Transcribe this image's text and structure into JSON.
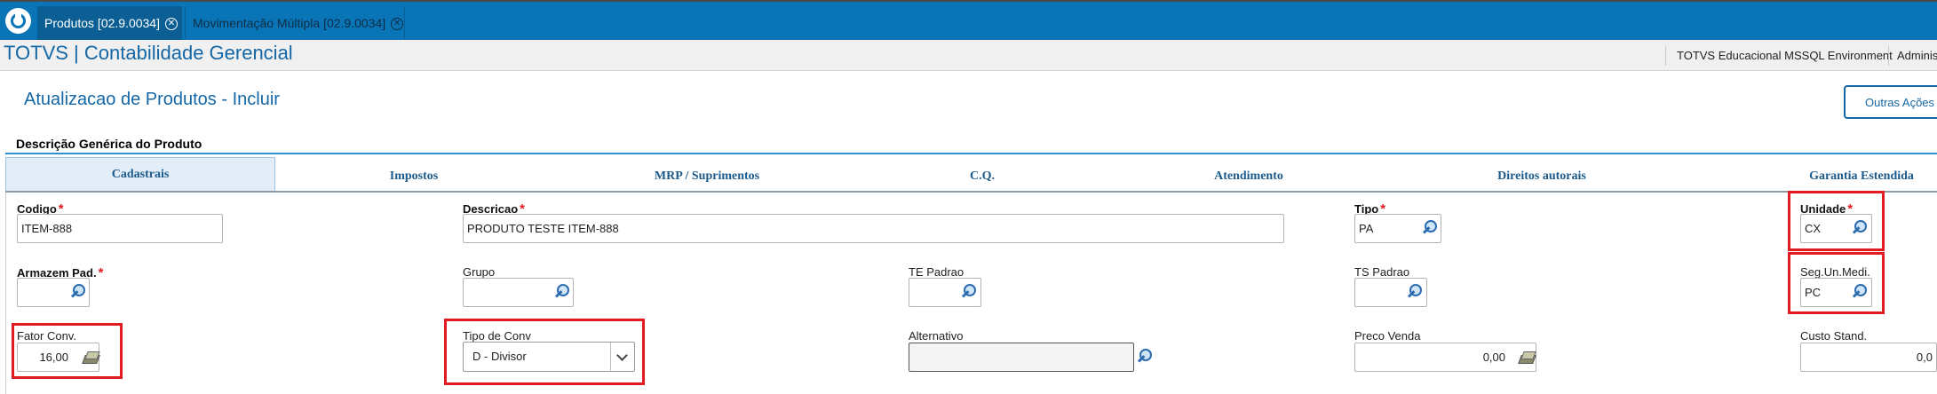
{
  "tabs": [
    {
      "label": "Produtos [02.9.0034]",
      "active": true
    },
    {
      "label": "Movimentação Múltipla [02.9.0034]",
      "active": false
    }
  ],
  "header": {
    "app_title": "TOTVS | Contabilidade Gerencial",
    "environment": "TOTVS Educacional MSSQL Environment",
    "user": "Administ"
  },
  "page": {
    "title": "Atualizacao de Produtos - Incluir",
    "outras_acoes": "Outras Ações",
    "section": "Descrição Genérica do Produto"
  },
  "folders": [
    "Cadastrais",
    "Impostos",
    "MRP / Suprimentos",
    "C.Q.",
    "Atendimento",
    "Direitos autorais",
    "Garantia Estendida"
  ],
  "form": {
    "codigo": {
      "label": "Codigo",
      "value": "ITEM-888"
    },
    "descricao": {
      "label": "Descricao",
      "value": "PRODUTO TESTE ITEM-888"
    },
    "tipo": {
      "label": "Tipo",
      "value": "PA"
    },
    "unidade": {
      "label": "Unidade",
      "value": "CX"
    },
    "armazem": {
      "label": "Armazem Pad.",
      "value": ""
    },
    "grupo": {
      "label": "Grupo",
      "value": ""
    },
    "te_padrao": {
      "label": "TE Padrao",
      "value": ""
    },
    "ts_padrao": {
      "label": "TS Padrao",
      "value": ""
    },
    "seg_un": {
      "label": "Seg.Un.Medi.",
      "value": "PC"
    },
    "fator_conv": {
      "label": "Fator Conv.",
      "value": "16,00"
    },
    "tipo_conv": {
      "label": "Tipo de Conv",
      "value": "D - Divisor"
    },
    "alternativo": {
      "label": "Alternativo",
      "value": ""
    },
    "preco_venda": {
      "label": "Preco Venda",
      "value": "0,00"
    },
    "custo_stand": {
      "label": "Custo Stand.",
      "value": "0,0"
    }
  },
  "colors": {
    "accent": "#0a75b6",
    "required": "#e11b22",
    "highlight": "#e11b22"
  }
}
